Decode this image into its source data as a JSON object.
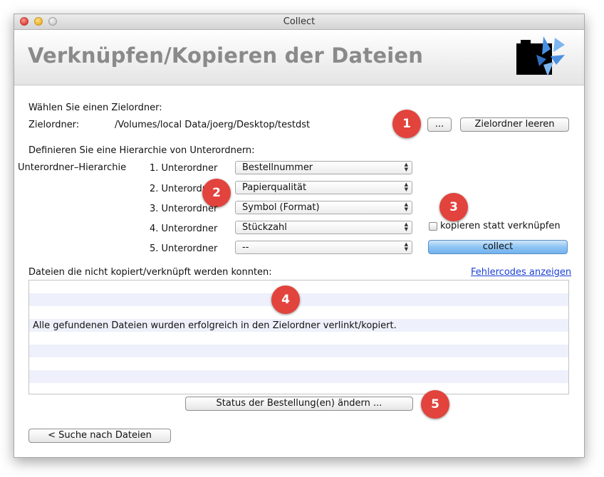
{
  "window": {
    "title": "Collect"
  },
  "header": {
    "title": "Verknüpfen/Kopieren der Dateien",
    "logo_icon": "collect-logo-icon"
  },
  "target": {
    "prompt": "Wählen Sie einen Zielordner:",
    "label": "Zielordner:",
    "path": "/Volumes/local Data/joerg/Desktop/testdst",
    "browse_label": "...",
    "clear_label": "Zielordner leeren"
  },
  "hierarchy": {
    "prompt": "Definieren Sie eine Hierarchie von Unterordnern:",
    "label": "Unterordner–Hierarchie",
    "levels": [
      {
        "label": "1. Unterordner",
        "value": "Bestellnummer"
      },
      {
        "label": "2. Unterordner",
        "value": "Papierqualität"
      },
      {
        "label": "3. Unterordner",
        "value": "Symbol (Format)"
      },
      {
        "label": "4. Unterordner",
        "value": "Stückzahl"
      },
      {
        "label": "5. Unterordner",
        "value": "--"
      }
    ]
  },
  "options": {
    "copy_checkbox_label": "kopieren statt verknüpfen",
    "copy_checked": false,
    "collect_label": "collect"
  },
  "results": {
    "label": "Dateien die nicht kopiert/verknüpft werden konnten:",
    "error_link": "Fehlercodes anzeigen",
    "message": "Alle gefundenen Dateien wurden erfolgreich in den Zielordner verlinkt/kopiert."
  },
  "actions": {
    "status_label": "Status der Bestellung(en) ändern ...",
    "back_label": "< Suche nach Dateien"
  },
  "callouts": [
    "1",
    "2",
    "3",
    "4",
    "5"
  ],
  "colors": {
    "callout": "#e2433d",
    "link": "#1a3fd6",
    "collect_button": "#8ec4f3",
    "header_title": "#8a8a8a"
  }
}
